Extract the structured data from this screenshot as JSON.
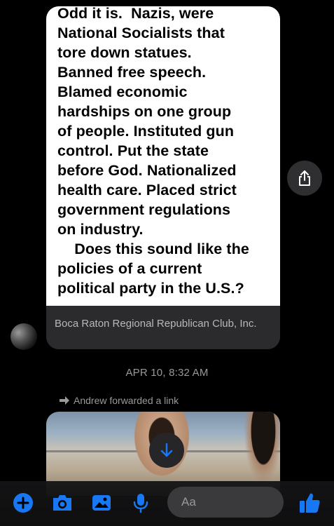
{
  "message1": {
    "image_text": "Odd it is.  Nazis, were\nNational Socialists that\ntore down statues.\nBanned free speech.\nBlamed economic\nhardships on one group\nof people. Instituted gun\ncontrol. Put the state\nbefore God. Nationalized\nhealth care. Placed strict\ngovernment regulations\non industry.\n    Does this sound like the\npolicies of a current\npolitical party in the U.S.?",
    "link_title": "Boca Raton Regional Republican Club, Inc."
  },
  "icons": {
    "share": "share-icon",
    "scroll_down": "arrow-down-icon",
    "forward": "forward-arrow-icon",
    "plus": "plus-icon",
    "camera": "camera-icon",
    "gallery": "image-icon",
    "mic": "microphone-icon",
    "emoji": "emoji-icon",
    "like": "thumbs-up-icon"
  },
  "timestamp": "APR 10, 8:32 AM",
  "forwarded_label": "Andrew forwarded a link",
  "composer": {
    "placeholder": "Aa"
  },
  "colors": {
    "accent": "#1877F2",
    "background": "#000000",
    "meta_text": "#98989d"
  }
}
